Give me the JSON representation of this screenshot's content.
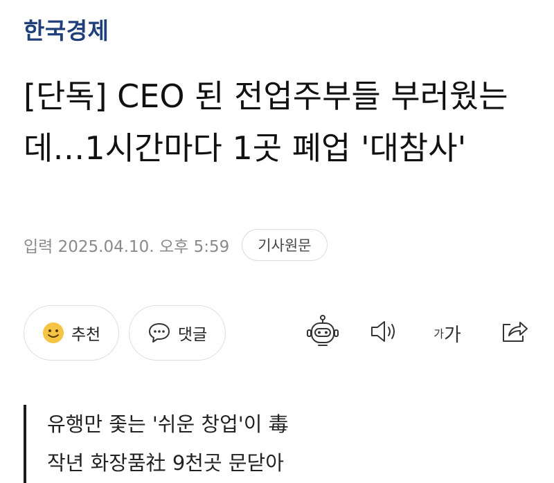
{
  "publisher": {
    "name": "한국경제"
  },
  "article": {
    "headline": "[단독] CEO 된 전업주부들 부러웠는데…1시간마다 1곳 폐업 '대참사'",
    "published": "입력 2025.04.10. 오후 5:59",
    "source_button_label": "기사원문"
  },
  "actions": {
    "recommend_label": "추천",
    "comment_label": "댓글",
    "font_small_glyph": "가",
    "font_large_glyph": "가"
  },
  "icons": {
    "recommend": "smiley-icon",
    "comment": "speech-bubble-icon",
    "summary_bot": "robot-icon",
    "read_aloud": "speaker-icon",
    "font_size": "font-size-icon",
    "share": "share-icon"
  },
  "subheadings": [
    "유행만 좇는 '쉬운 창업'이 毒",
    "작년 화장품社 9천곳 문닫아"
  ],
  "colors": {
    "publisher": "#1f3f7a",
    "smiley": "#f6c445"
  }
}
